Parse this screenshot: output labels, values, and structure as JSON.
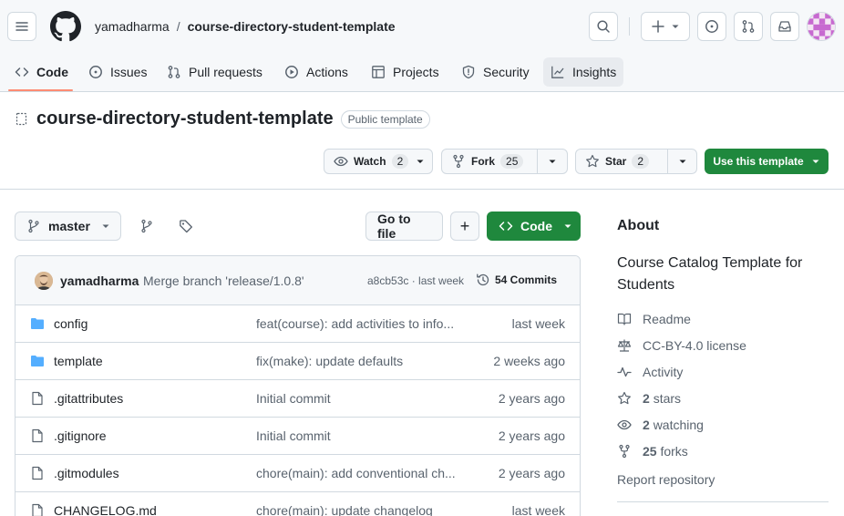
{
  "header": {
    "owner": "yamadharma",
    "separator": "/",
    "repo": "course-directory-student-template"
  },
  "tabs": [
    {
      "label": "Code",
      "icon": "code-icon"
    },
    {
      "label": "Issues",
      "icon": "issue-icon"
    },
    {
      "label": "Pull requests",
      "icon": "pull-request-icon"
    },
    {
      "label": "Actions",
      "icon": "play-icon"
    },
    {
      "label": "Projects",
      "icon": "table-icon"
    },
    {
      "label": "Security",
      "icon": "shield-icon"
    },
    {
      "label": "Insights",
      "icon": "graph-icon"
    }
  ],
  "repo": {
    "name": "course-directory-student-template",
    "visibility": "Public template"
  },
  "actions": {
    "watch_label": "Watch",
    "watch_count": "2",
    "fork_label": "Fork",
    "fork_count": "25",
    "star_label": "Star",
    "star_count": "2",
    "use_template": "Use this template"
  },
  "branch_bar": {
    "branch": "master",
    "go_to_file": "Go to file",
    "add": "+",
    "code": "Code"
  },
  "commit": {
    "author": "yamadharma",
    "message": "Merge branch 'release/1.0.8'",
    "meta": "a8cb53c · last week",
    "count": "54 Commits"
  },
  "files": [
    {
      "type": "folder",
      "name": "config",
      "message": "feat(course): add activities to info...",
      "date": "last week"
    },
    {
      "type": "folder",
      "name": "template",
      "message": "fix(make): update defaults",
      "date": "2 weeks ago"
    },
    {
      "type": "file",
      "name": ".gitattributes",
      "message": "Initial commit",
      "date": "2 years ago"
    },
    {
      "type": "file",
      "name": ".gitignore",
      "message": "Initial commit",
      "date": "2 years ago"
    },
    {
      "type": "file",
      "name": ".gitmodules",
      "message": "chore(main): add conventional ch...",
      "date": "2 years ago"
    },
    {
      "type": "file",
      "name": "CHANGELOG.md",
      "message": "chore(main): update changelog",
      "date": "last week"
    }
  ],
  "about": {
    "heading": "About",
    "description": "Course Catalog Template for Students",
    "readme": "Readme",
    "license": "CC-BY-4.0 license",
    "activity": "Activity",
    "stars_count": "2",
    "stars_label": "stars",
    "watching_count": "2",
    "watching_label": "watching",
    "forks_count": "25",
    "forks_label": "forks",
    "report": "Report repository"
  },
  "colors": {
    "accent_green": "#1f883d",
    "folder_blue": "#54aeff",
    "tab_underline": "#fd8c73"
  }
}
